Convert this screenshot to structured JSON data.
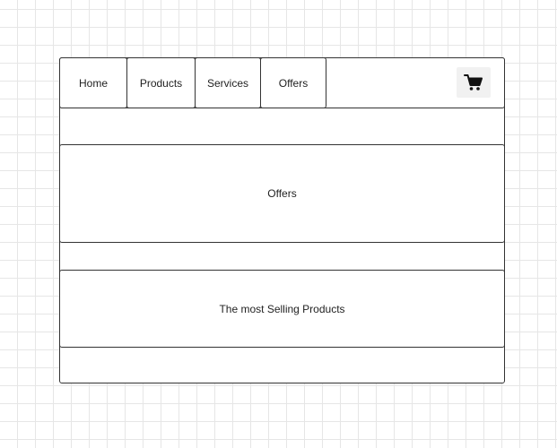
{
  "nav": {
    "items": [
      {
        "label": "Home"
      },
      {
        "label": "Products"
      },
      {
        "label": "Services"
      },
      {
        "label": "Offers"
      }
    ],
    "cart_icon": "shopping-cart-icon"
  },
  "sections": {
    "offers": {
      "label": "Offers"
    },
    "best_sellers": {
      "label": "The most Selling Products"
    }
  }
}
